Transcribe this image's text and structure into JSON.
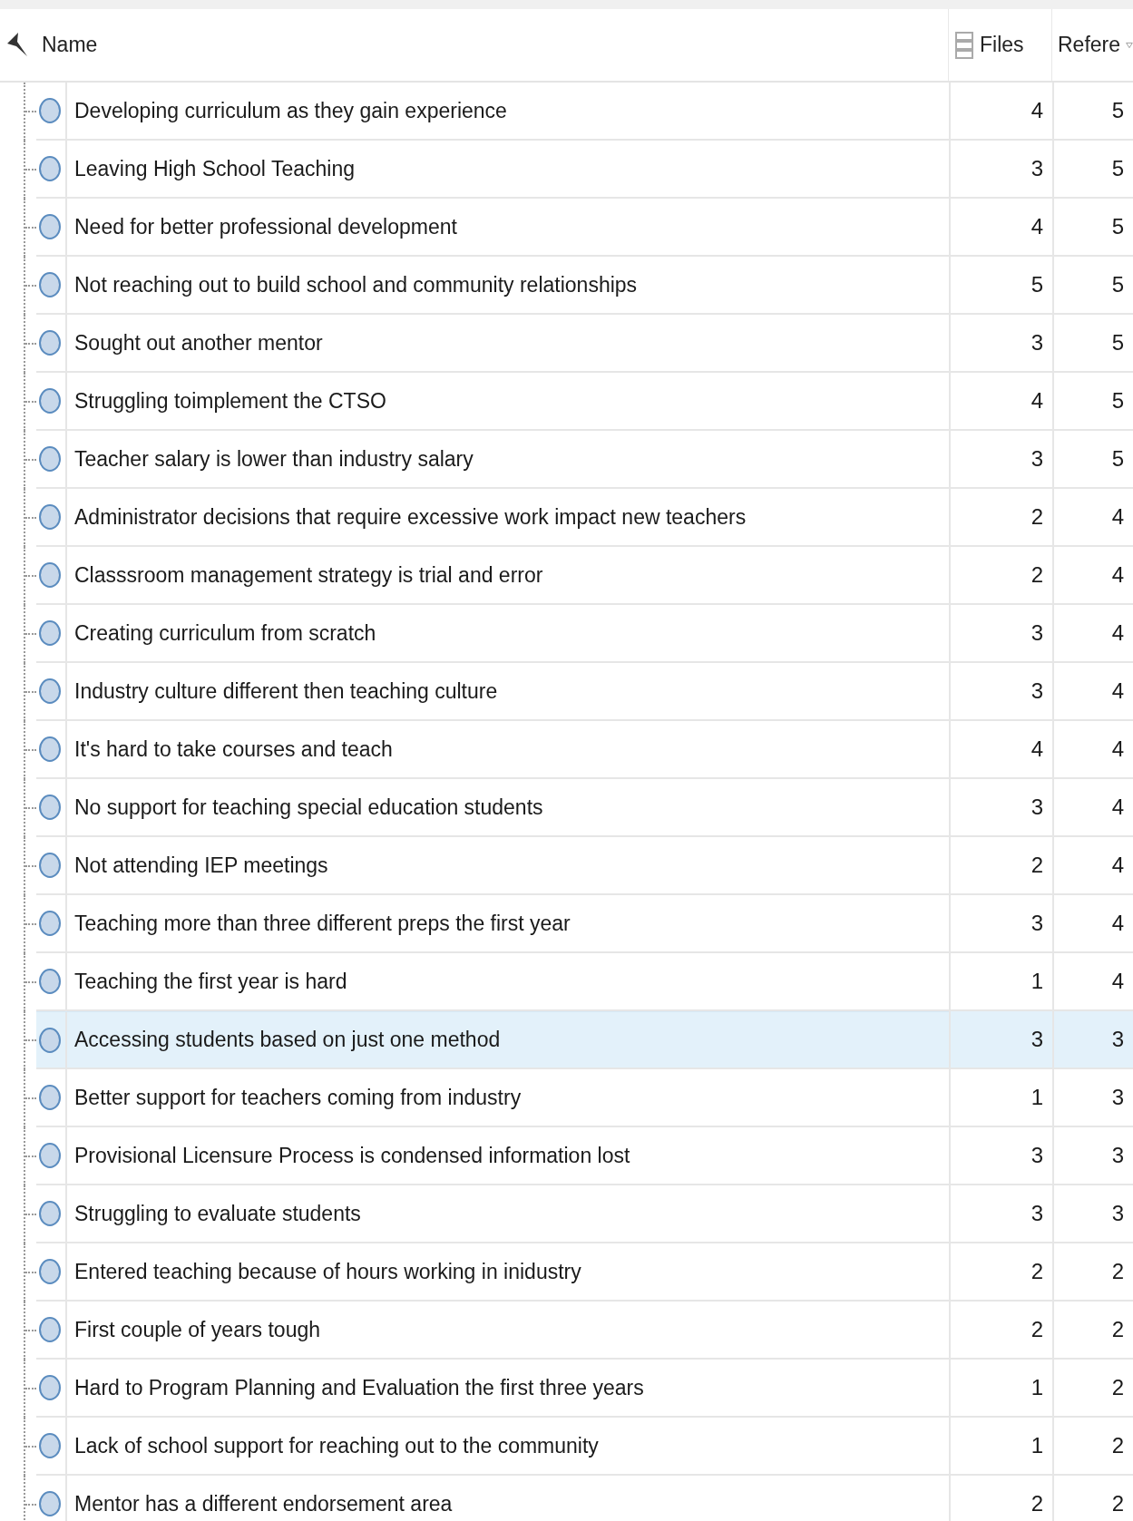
{
  "table": {
    "columns": [
      {
        "label": "Name"
      },
      {
        "label": "Files"
      },
      {
        "label": "Refere",
        "sorted": true
      }
    ],
    "rows": [
      {
        "name": "Developing curriculum as they gain experience",
        "files": "4",
        "references": "5",
        "selected": false
      },
      {
        "name": "Leaving High School Teaching",
        "files": "3",
        "references": "5",
        "selected": false
      },
      {
        "name": "Need for better professional development",
        "files": "4",
        "references": "5",
        "selected": false
      },
      {
        "name": "Not reaching out to build school and community relationships",
        "files": "5",
        "references": "5",
        "selected": false
      },
      {
        "name": "Sought out another mentor",
        "files": "3",
        "references": "5",
        "selected": false
      },
      {
        "name": "Struggling toimplement the CTSO",
        "files": "4",
        "references": "5",
        "selected": false
      },
      {
        "name": "Teacher salary is lower than industry salary",
        "files": "3",
        "references": "5",
        "selected": false
      },
      {
        "name": "Administrator decisions that require excessive work impact new teachers",
        "files": "2",
        "references": "4",
        "selected": false
      },
      {
        "name": "Classsroom management strategy is trial and error",
        "files": "2",
        "references": "4",
        "selected": false
      },
      {
        "name": "Creating curriculum from scratch",
        "files": "3",
        "references": "4",
        "selected": false
      },
      {
        "name": "Industry culture different then teaching culture",
        "files": "3",
        "references": "4",
        "selected": false
      },
      {
        "name": "It's hard to take courses and teach",
        "files": "4",
        "references": "4",
        "selected": false
      },
      {
        "name": "No support for teaching special education students",
        "files": "3",
        "references": "4",
        "selected": false
      },
      {
        "name": "Not attending IEP meetings",
        "files": "2",
        "references": "4",
        "selected": false
      },
      {
        "name": "Teaching more than three different preps the first year",
        "files": "3",
        "references": "4",
        "selected": false
      },
      {
        "name": "Teaching the first year is hard",
        "files": "1",
        "references": "4",
        "selected": false
      },
      {
        "name": "Accessing students based on just one method",
        "files": "3",
        "references": "3",
        "selected": true
      },
      {
        "name": "Better support for teachers coming from industry",
        "files": "1",
        "references": "3",
        "selected": false
      },
      {
        "name": "Provisional Licensure Process is condensed information lost",
        "files": "3",
        "references": "3",
        "selected": false
      },
      {
        "name": "Struggling to evaluate students",
        "files": "3",
        "references": "3",
        "selected": false
      },
      {
        "name": "Entered teaching because of hours working in inidustry",
        "files": "2",
        "references": "2",
        "selected": false
      },
      {
        "name": "First couple of years tough",
        "files": "2",
        "references": "2",
        "selected": false
      },
      {
        "name": "Hard to Program Planning and Evaluation the first three years",
        "files": "1",
        "references": "2",
        "selected": false
      },
      {
        "name": "Lack of school support for reaching out to the community",
        "files": "1",
        "references": "2",
        "selected": false
      },
      {
        "name": "Mentor has a different endorsement area",
        "files": "2",
        "references": "2",
        "selected": false
      }
    ]
  }
}
